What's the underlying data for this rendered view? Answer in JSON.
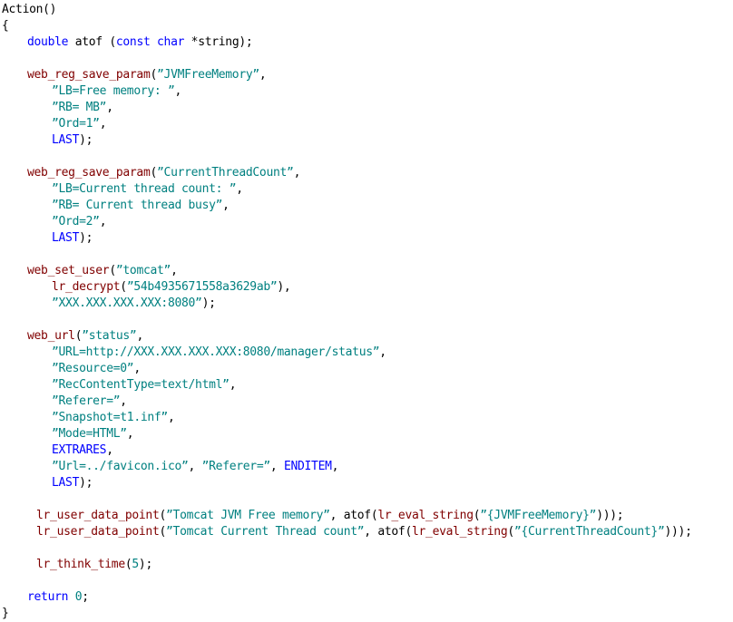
{
  "editor": {
    "title": "Action()",
    "language": "C",
    "background_color": "#ffffff",
    "colors": {
      "keyword": "#0000ff",
      "function": "#800000",
      "string": "#008080",
      "number": "#008080",
      "plain": "#000000"
    }
  },
  "code": {
    "lines": [
      {
        "id": "l1",
        "indent": 0,
        "tokens": [
          {
            "t": "plain",
            "v": "Action()"
          }
        ]
      },
      {
        "id": "l2",
        "indent": 0,
        "tokens": [
          {
            "t": "plain",
            "v": "{"
          }
        ]
      },
      {
        "id": "l3",
        "indent": 28,
        "tokens": [
          {
            "t": "kw",
            "v": "double"
          },
          {
            "t": "plain",
            "v": " atof ("
          },
          {
            "t": "kw",
            "v": "const"
          },
          {
            "t": "plain",
            "v": " "
          },
          {
            "t": "kw",
            "v": "char"
          },
          {
            "t": "plain",
            "v": " *string);"
          }
        ]
      },
      {
        "id": "l4",
        "indent": 0,
        "tokens": [
          {
            "t": "plain",
            "v": ""
          }
        ]
      },
      {
        "id": "l5",
        "indent": 28,
        "tokens": [
          {
            "t": "fn",
            "v": "web_reg_save_param"
          },
          {
            "t": "plain",
            "v": "("
          },
          {
            "t": "str",
            "v": "”JVMFreeMemory”"
          },
          {
            "t": "plain",
            "v": ","
          }
        ]
      },
      {
        "id": "l6",
        "indent": 55,
        "tokens": [
          {
            "t": "str",
            "v": "”LB=Free memory: ”"
          },
          {
            "t": "plain",
            "v": ","
          }
        ]
      },
      {
        "id": "l7",
        "indent": 55,
        "tokens": [
          {
            "t": "str",
            "v": "”RB= MB”"
          },
          {
            "t": "plain",
            "v": ","
          }
        ]
      },
      {
        "id": "l8",
        "indent": 55,
        "tokens": [
          {
            "t": "str",
            "v": "”Ord=1”"
          },
          {
            "t": "plain",
            "v": ","
          }
        ]
      },
      {
        "id": "l9",
        "indent": 55,
        "tokens": [
          {
            "t": "kw",
            "v": "LAST"
          },
          {
            "t": "plain",
            "v": ");"
          }
        ]
      },
      {
        "id": "l10",
        "indent": 0,
        "tokens": [
          {
            "t": "plain",
            "v": ""
          }
        ]
      },
      {
        "id": "l11",
        "indent": 28,
        "tokens": [
          {
            "t": "fn",
            "v": "web_reg_save_param"
          },
          {
            "t": "plain",
            "v": "("
          },
          {
            "t": "str",
            "v": "”CurrentThreadCount”"
          },
          {
            "t": "plain",
            "v": ","
          }
        ]
      },
      {
        "id": "l12",
        "indent": 55,
        "tokens": [
          {
            "t": "str",
            "v": "”LB=Current thread count: ”"
          },
          {
            "t": "plain",
            "v": ","
          }
        ]
      },
      {
        "id": "l13",
        "indent": 55,
        "tokens": [
          {
            "t": "str",
            "v": "”RB= Current thread busy”"
          },
          {
            "t": "plain",
            "v": ","
          }
        ]
      },
      {
        "id": "l14",
        "indent": 55,
        "tokens": [
          {
            "t": "str",
            "v": "”Ord=2”"
          },
          {
            "t": "plain",
            "v": ","
          }
        ]
      },
      {
        "id": "l15",
        "indent": 55,
        "tokens": [
          {
            "t": "kw",
            "v": "LAST"
          },
          {
            "t": "plain",
            "v": ");"
          }
        ]
      },
      {
        "id": "l16",
        "indent": 0,
        "tokens": [
          {
            "t": "plain",
            "v": ""
          }
        ]
      },
      {
        "id": "l17",
        "indent": 28,
        "tokens": [
          {
            "t": "fn",
            "v": "web_set_user"
          },
          {
            "t": "plain",
            "v": "("
          },
          {
            "t": "str",
            "v": "”tomcat”"
          },
          {
            "t": "plain",
            "v": ","
          }
        ]
      },
      {
        "id": "l18",
        "indent": 55,
        "tokens": [
          {
            "t": "fn",
            "v": "lr_decrypt"
          },
          {
            "t": "plain",
            "v": "("
          },
          {
            "t": "str",
            "v": "”54b4935671558a3629ab”"
          },
          {
            "t": "plain",
            "v": "),"
          }
        ]
      },
      {
        "id": "l19",
        "indent": 55,
        "tokens": [
          {
            "t": "str",
            "v": "”XXX.XXX.XXX.XXX:8080”"
          },
          {
            "t": "plain",
            "v": ");"
          }
        ]
      },
      {
        "id": "l20",
        "indent": 0,
        "tokens": [
          {
            "t": "plain",
            "v": ""
          }
        ]
      },
      {
        "id": "l21",
        "indent": 28,
        "tokens": [
          {
            "t": "fn",
            "v": "web_url"
          },
          {
            "t": "plain",
            "v": "("
          },
          {
            "t": "str",
            "v": "”status”"
          },
          {
            "t": "plain",
            "v": ","
          }
        ]
      },
      {
        "id": "l22",
        "indent": 55,
        "tokens": [
          {
            "t": "str",
            "v": "”URL=http://XXX.XXX.XXX.XXX:8080/manager/status”"
          },
          {
            "t": "plain",
            "v": ","
          }
        ]
      },
      {
        "id": "l23",
        "indent": 55,
        "tokens": [
          {
            "t": "str",
            "v": "”Resource=0”"
          },
          {
            "t": "plain",
            "v": ","
          }
        ]
      },
      {
        "id": "l24",
        "indent": 55,
        "tokens": [
          {
            "t": "str",
            "v": "”RecContentType=text/html”"
          },
          {
            "t": "plain",
            "v": ","
          }
        ]
      },
      {
        "id": "l25",
        "indent": 55,
        "tokens": [
          {
            "t": "str",
            "v": "”Referer=”"
          },
          {
            "t": "plain",
            "v": ","
          }
        ]
      },
      {
        "id": "l26",
        "indent": 55,
        "tokens": [
          {
            "t": "str",
            "v": "”Snapshot=t1.inf”"
          },
          {
            "t": "plain",
            "v": ","
          }
        ]
      },
      {
        "id": "l27",
        "indent": 55,
        "tokens": [
          {
            "t": "str",
            "v": "”Mode=HTML”"
          },
          {
            "t": "plain",
            "v": ","
          }
        ]
      },
      {
        "id": "l28",
        "indent": 55,
        "tokens": [
          {
            "t": "kw",
            "v": "EXTRARES"
          },
          {
            "t": "plain",
            "v": ","
          }
        ]
      },
      {
        "id": "l29",
        "indent": 55,
        "tokens": [
          {
            "t": "str",
            "v": "”Url=../favicon.ico”"
          },
          {
            "t": "plain",
            "v": ", "
          },
          {
            "t": "str",
            "v": "”Referer=”"
          },
          {
            "t": "plain",
            "v": ", "
          },
          {
            "t": "kw",
            "v": "ENDITEM"
          },
          {
            "t": "plain",
            "v": ","
          }
        ]
      },
      {
        "id": "l30",
        "indent": 55,
        "tokens": [
          {
            "t": "kw",
            "v": "LAST"
          },
          {
            "t": "plain",
            "v": ");"
          }
        ]
      },
      {
        "id": "l31",
        "indent": 0,
        "tokens": [
          {
            "t": "plain",
            "v": ""
          }
        ]
      },
      {
        "id": "l32",
        "indent": 38,
        "tokens": [
          {
            "t": "fn",
            "v": "lr_user_data_point"
          },
          {
            "t": "plain",
            "v": "("
          },
          {
            "t": "str",
            "v": "”Tomcat JVM Free memory”"
          },
          {
            "t": "plain",
            "v": ", atof("
          },
          {
            "t": "fn",
            "v": "lr_eval_string"
          },
          {
            "t": "plain",
            "v": "("
          },
          {
            "t": "str",
            "v": "”{JVMFreeMemory}”"
          },
          {
            "t": "plain",
            "v": ")));"
          }
        ]
      },
      {
        "id": "l33",
        "indent": 38,
        "tokens": [
          {
            "t": "fn",
            "v": "lr_user_data_point"
          },
          {
            "t": "plain",
            "v": "("
          },
          {
            "t": "str",
            "v": "”Tomcat Current Thread count”"
          },
          {
            "t": "plain",
            "v": ", atof("
          },
          {
            "t": "fn",
            "v": "lr_eval_string"
          },
          {
            "t": "plain",
            "v": "("
          },
          {
            "t": "str",
            "v": "”{CurrentThreadCount}”"
          },
          {
            "t": "plain",
            "v": ")));"
          }
        ]
      },
      {
        "id": "l34",
        "indent": 0,
        "tokens": [
          {
            "t": "plain",
            "v": ""
          }
        ]
      },
      {
        "id": "l35",
        "indent": 38,
        "tokens": [
          {
            "t": "fn",
            "v": "lr_think_time"
          },
          {
            "t": "plain",
            "v": "("
          },
          {
            "t": "num",
            "v": "5"
          },
          {
            "t": "plain",
            "v": ");"
          }
        ]
      },
      {
        "id": "l36",
        "indent": 0,
        "tokens": [
          {
            "t": "plain",
            "v": ""
          }
        ]
      },
      {
        "id": "l37",
        "indent": 28,
        "tokens": [
          {
            "t": "kw",
            "v": "return"
          },
          {
            "t": "plain",
            "v": " "
          },
          {
            "t": "num",
            "v": "0"
          },
          {
            "t": "plain",
            "v": ";"
          }
        ]
      },
      {
        "id": "l38",
        "indent": 0,
        "tokens": [
          {
            "t": "plain",
            "v": "}"
          }
        ]
      }
    ]
  }
}
